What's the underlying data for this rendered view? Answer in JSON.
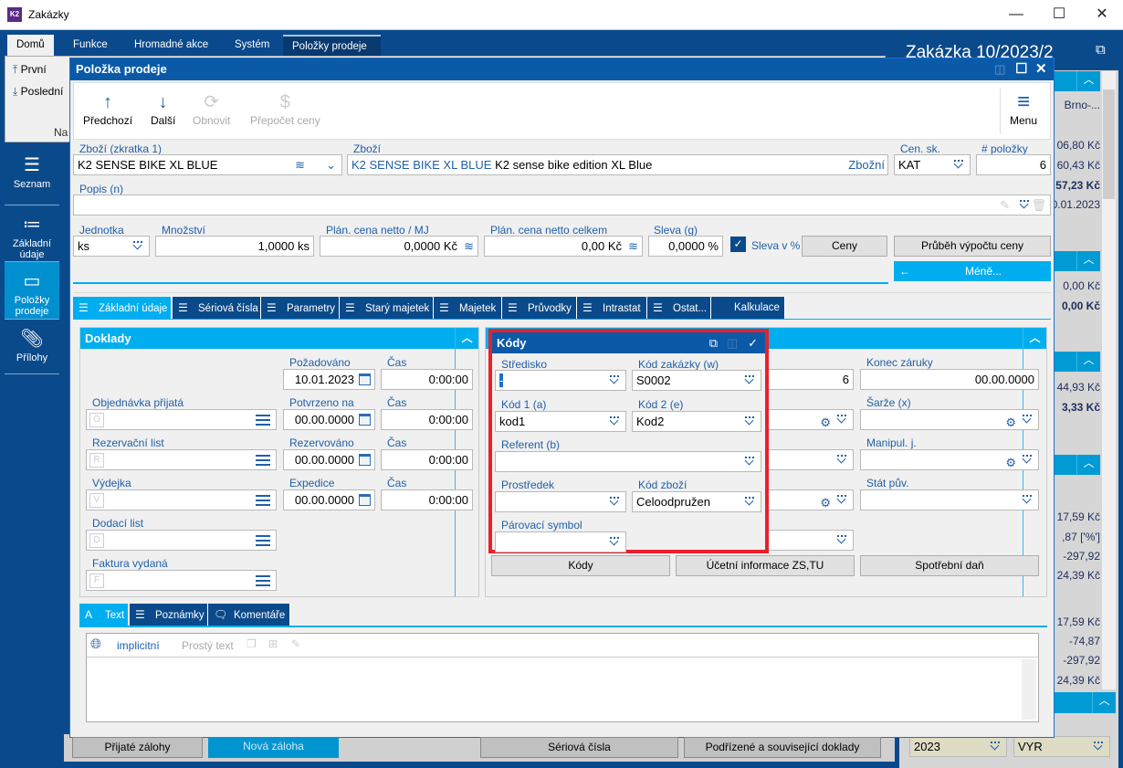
{
  "window": {
    "title": "Zakázky",
    "app_icon": "K2",
    "controls": [
      "minimize",
      "maximize",
      "close"
    ]
  },
  "ribbon": {
    "tabs": [
      "Domů",
      "Funkce",
      "Hromadné akce",
      "Systém",
      "Položky prodeje"
    ],
    "items": [
      "První",
      "Poslední"
    ],
    "group_label": "Na"
  },
  "sidebar": {
    "items": [
      {
        "label": "Seznam",
        "icon": "list-icon"
      },
      {
        "label": "Základní údaje",
        "icon": "bullet-list-icon"
      },
      {
        "label": "Položky prodeje",
        "icon": "box-icon",
        "active": true
      },
      {
        "label": "Přílohy",
        "icon": "paperclip-icon"
      }
    ]
  },
  "right_panel": {
    "title": "Zakázka 10/2023/2",
    "s1": [
      "Brno-...",
      "06,80 Kč",
      "60,43 Kč",
      "57,23 Kč",
      "0.01.2023"
    ],
    "s2": [
      "0,00 Kč",
      "0,00 Kč"
    ],
    "s3": [
      "44,93 Kč",
      "3,33 Kč"
    ],
    "s4": [
      "17,59 Kč",
      ",87 ['%']",
      "-297,92",
      "24,39 Kč"
    ],
    "s5": [
      "17,59 Kč",
      "-74,87",
      "-297,92",
      "24,39 Kč"
    ],
    "year": "2023",
    "vyr": "VYR"
  },
  "dialog": {
    "title": "Položka prodeje",
    "toolbar": {
      "prev": "Předchozí",
      "next": "Další",
      "refresh": "Obnovit",
      "recalc": "Přepočet ceny",
      "menu": "Menu"
    },
    "fields": {
      "zbozi_zkratka": {
        "label": "Zboží (zkratka 1)",
        "value": "K2 SENSE BIKE XL BLUE"
      },
      "zbozi": {
        "label": "Zboží",
        "code": "K2 SENSE BIKE XL BLUE",
        "name": "K2 sense bike edition XL Blue",
        "suffix": "Zbožní"
      },
      "cen_sk": {
        "label": "Cen. sk.",
        "value": "KAT"
      },
      "polozky": {
        "label": "# položky",
        "value": "6"
      },
      "popis": {
        "label": "Popis (n)",
        "value": ""
      },
      "jednotka": {
        "label": "Jednotka",
        "value": "ks"
      },
      "mnozstvi": {
        "label": "Množství",
        "value": "1,0000 ks"
      },
      "cena_mj": {
        "label": "Plán. cena netto / MJ",
        "value": "0,0000 Kč"
      },
      "cena_celkem": {
        "label": "Plán. cena netto celkem",
        "value": "0,00 Kč"
      },
      "sleva": {
        "label": "Sleva (g)",
        "value": "0,0000 %"
      },
      "sleva_pct": {
        "label": "Sleva v %",
        "checked": true
      }
    },
    "buttons": {
      "ceny": "Ceny",
      "prubeh": "Průběh výpočtu ceny",
      "mene": "Méně..."
    },
    "tabs": [
      "Základní údaje",
      "Sériová čísla",
      "Parametry",
      "Starý majetek",
      "Majetek",
      "Průvodky",
      "Intrastat",
      "Ostat...",
      "Kalkulace"
    ],
    "doklady": {
      "title": "Doklady",
      "docs": [
        {
          "label": "Objednávka přijatá",
          "letter": "O"
        },
        {
          "label": "Rezervační list",
          "letter": "R"
        },
        {
          "label": "Výdejka",
          "letter": "V"
        },
        {
          "label": "Dodací list",
          "letter": "D"
        },
        {
          "label": "Faktura vydaná",
          "letter": "F"
        }
      ],
      "dates": [
        {
          "label": "Požadováno",
          "value": "10.01.2023"
        },
        {
          "label": "Potvrzeno na",
          "value": "00.00.0000"
        },
        {
          "label": "Rezervováno",
          "value": "00.00.0000"
        },
        {
          "label": "Expedice",
          "value": "00.00.0000"
        }
      ],
      "time_label": "Čas",
      "time_value": "0:00:00"
    },
    "right": {
      "konec_zaruky": {
        "label": "Konec záruky",
        "value": "00.00.0000"
      },
      "sarze": "Šarže (x)",
      "manipul": "Manipul. j.",
      "stat": "Stát pův.",
      "hidden_value": "6",
      "buttons": [
        "Kódy",
        "Účetní informace ZS,TU",
        "Spotřební daň"
      ]
    },
    "kody": {
      "title": "Kódy",
      "highlight_color": "#e8202a",
      "fields": [
        {
          "label": "Středisko",
          "value": "-"
        },
        {
          "label": "Kód zakázky (w)",
          "value": "S0002"
        },
        {
          "label": "Kód 1 (a)",
          "value": "kod1"
        },
        {
          "label": "Kód 2 (e)",
          "value": "Kod2"
        },
        {
          "label": "Referent (b)",
          "value": ""
        },
        {
          "label": "Prostředek",
          "value": ""
        },
        {
          "label": "Kód zboží",
          "value": "Celoodpružen"
        },
        {
          "label": "Párovací symbol",
          "value": ""
        }
      ]
    },
    "text_tabs": [
      "Text",
      "Poznámky",
      "Komentáře"
    ],
    "editor": {
      "language": "implicitní",
      "format": "Prostý text"
    }
  },
  "bottom": {
    "buttons": [
      "Přijaté zálohy",
      "Nová záloha",
      "Sériová čísla",
      "Podřízené a související doklady"
    ]
  },
  "colors": {
    "dark_blue": "#0b4a8a",
    "accent": "#00aeef",
    "title_blue": "#0b5aa8"
  }
}
